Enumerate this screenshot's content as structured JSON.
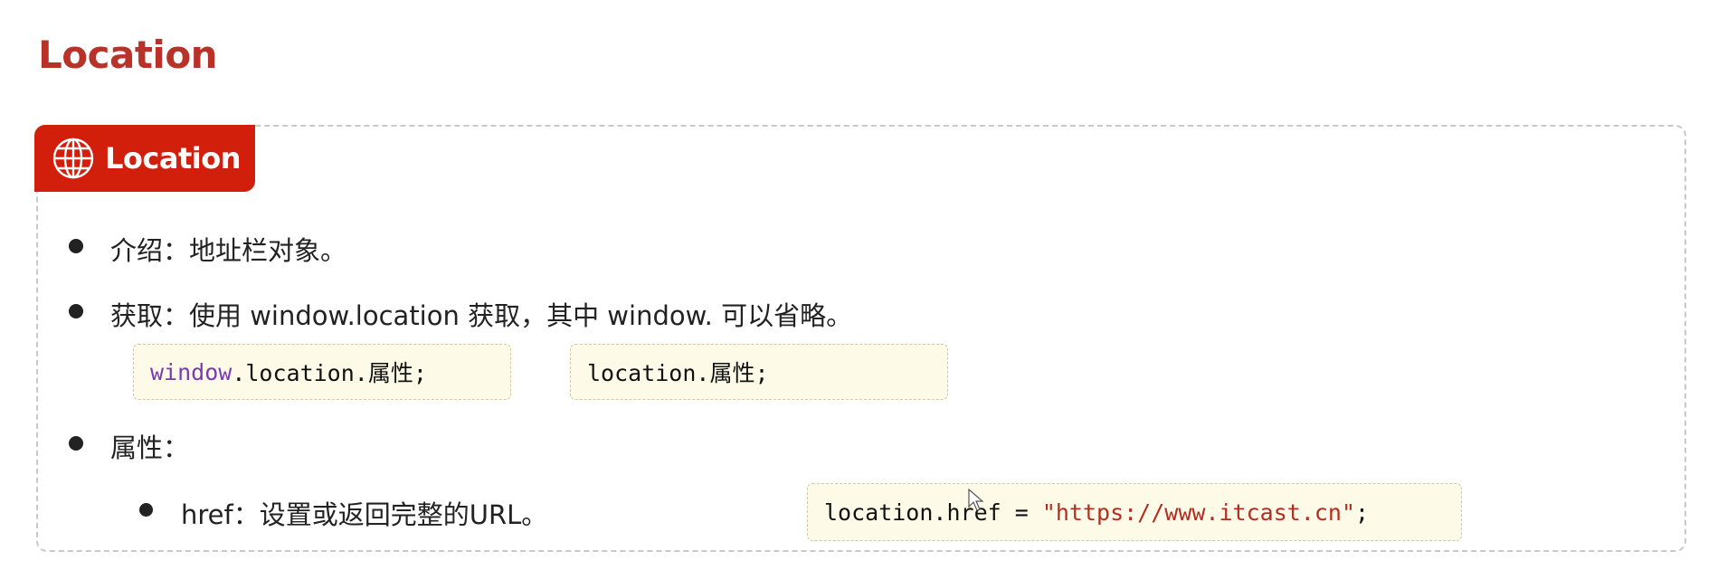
{
  "page": {
    "title": "Location"
  },
  "card": {
    "tab_label": "Location",
    "tab_icon": "globe-icon",
    "accent_color": "#d11f0b",
    "title_color": "#b8322a"
  },
  "bullets": [
    {
      "text": "介绍：地址栏对象。"
    },
    {
      "text": "获取：使用 window.location 获取，其中 window. 可以省略。"
    },
    {
      "text": "属性："
    }
  ],
  "code_get": [
    {
      "keyword": "window",
      "rest": ".location.属性;"
    },
    {
      "text": "location.属性;"
    }
  ],
  "sub_bullets": [
    {
      "text": "href：设置或返回完整的URL。"
    }
  ],
  "code_href": {
    "prefix": "location.href = ",
    "string": "\"https://www.itcast.cn\"",
    "suffix": ";"
  }
}
